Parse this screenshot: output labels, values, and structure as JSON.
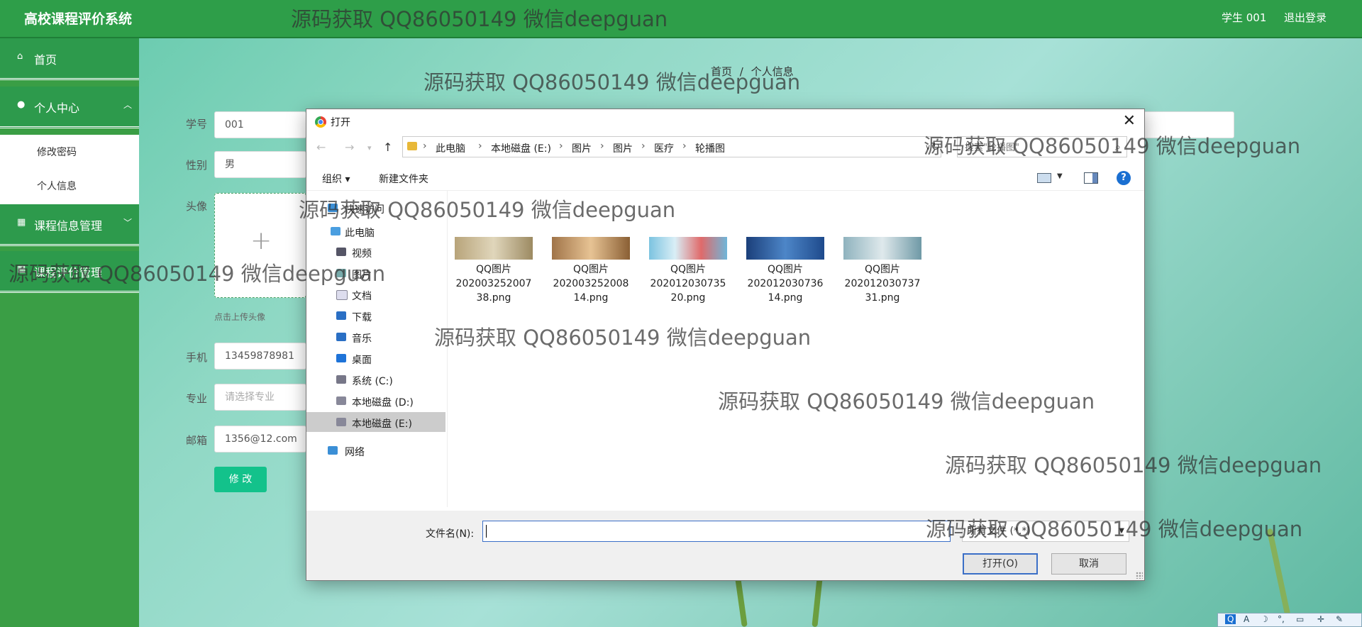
{
  "header": {
    "app_title": "高校课程评价系统",
    "user_label": "学生 001",
    "logout": "退出登录"
  },
  "sidebar": {
    "items": [
      {
        "label": "首页",
        "icon": "home-icon"
      },
      {
        "label": "个人中心",
        "icon": "user-icon",
        "expanded": true
      },
      {
        "label": "课程信息管理",
        "icon": "grid-icon"
      },
      {
        "label": "课程评价管理",
        "icon": "grid-icon"
      }
    ],
    "sub_items": [
      "修改密码",
      "个人信息"
    ]
  },
  "breadcrumb": {
    "home": "首页",
    "sep": "/",
    "current": "个人信息"
  },
  "form": {
    "student_id_label": "学号",
    "student_id": "001",
    "gender_label": "性别",
    "gender": "男",
    "avatar_label": "头像",
    "avatar_hint": "点击上传头像",
    "phone_label": "手机",
    "phone": "13459878981",
    "major_label": "专业",
    "major_placeholder": "请选择专业",
    "email_label": "邮箱",
    "email": "1356@12.com",
    "submit": "修 改"
  },
  "dialog": {
    "title": "打开",
    "path": [
      "此电脑",
      "本地磁盘 (E:)",
      "图片",
      "图片",
      "医疗",
      "轮播图"
    ],
    "search_placeholder": "搜索\"轮播图\"",
    "toolbar": {
      "organize": "组织 ▾",
      "new_folder": "新建文件夹"
    },
    "nav_tree": [
      {
        "label": "快速访问",
        "icon": "star-icon"
      },
      {
        "label": "此电脑",
        "icon": "computer-icon"
      },
      {
        "label": "视频",
        "icon": "video-icon"
      },
      {
        "label": "图片",
        "icon": "picture-icon"
      },
      {
        "label": "文档",
        "icon": "document-icon"
      },
      {
        "label": "下载",
        "icon": "download-icon"
      },
      {
        "label": "音乐",
        "icon": "music-icon"
      },
      {
        "label": "桌面",
        "icon": "desktop-icon"
      },
      {
        "label": "系统 (C:)",
        "icon": "drive-icon"
      },
      {
        "label": "本地磁盘 (D:)",
        "icon": "drive-icon"
      },
      {
        "label": "本地磁盘 (E:)",
        "icon": "drive-icon",
        "selected": true
      },
      {
        "label": "网络",
        "icon": "network-icon"
      }
    ],
    "files": [
      {
        "line1": "QQ图片",
        "line2": "202003252007",
        "line3": "38.png"
      },
      {
        "line1": "QQ图片",
        "line2": "202003252008",
        "line3": "14.png"
      },
      {
        "line1": "QQ图片",
        "line2": "202012030735",
        "line3": "20.png"
      },
      {
        "line1": "QQ图片",
        "line2": "202012030736",
        "line3": "14.png"
      },
      {
        "line1": "QQ图片",
        "line2": "202012030737",
        "line3": "31.png"
      }
    ],
    "filename_label": "文件名(N):",
    "filename_value": "",
    "filetype": "所有文件 (*.*)",
    "open_btn": "打开(O)",
    "cancel_btn": "取消"
  },
  "watermark": "源码获取 QQ86050149 微信deepguan",
  "ime": [
    "Q",
    "A",
    "☽",
    "°,",
    "▭",
    "✛",
    "✎"
  ],
  "colors": {
    "header": "#2e9e49",
    "sidebar": "#2d9a4c",
    "submit": "#13c28b",
    "dialog_accent": "#3b6fc7"
  }
}
